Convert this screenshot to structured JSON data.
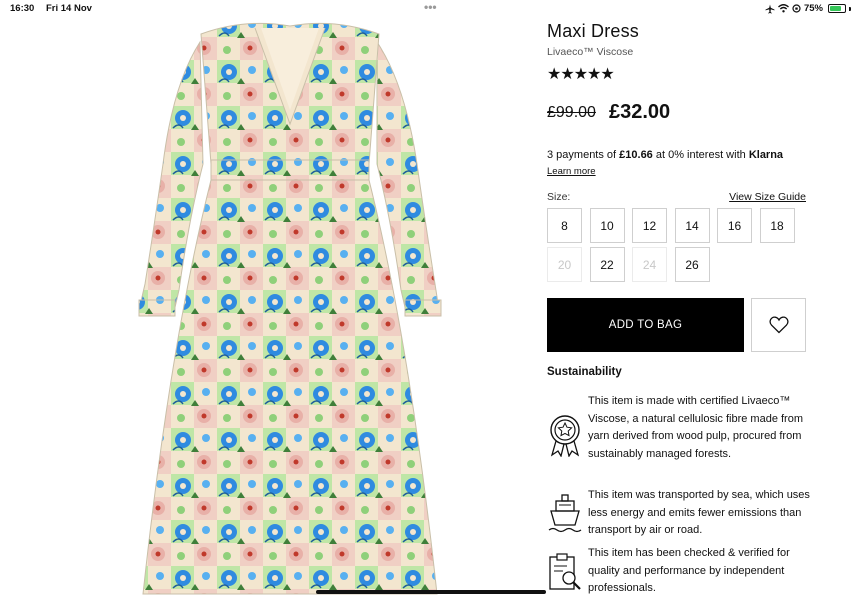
{
  "status_bar": {
    "time": "16:30",
    "date": "Fri 14 Nov",
    "dots": "•••",
    "battery": "75%"
  },
  "product": {
    "title": "Maxi Dress",
    "subtitle": "Livaeco™ Viscose",
    "rating_stars": "★★★★★",
    "rating_value": 5,
    "price_old": "£99.00",
    "price_new": "£32.00"
  },
  "klarna": {
    "prefix": "3 payments of ",
    "amount": "£10.66",
    "middle": " at 0% interest with ",
    "brand": "Klarna",
    "learn_more": "Learn more"
  },
  "sizes": {
    "label": "Size:",
    "guide_link": "View Size Guide",
    "options": [
      {
        "label": "8",
        "available": true
      },
      {
        "label": "10",
        "available": true
      },
      {
        "label": "12",
        "available": true
      },
      {
        "label": "14",
        "available": true
      },
      {
        "label": "16",
        "available": true
      },
      {
        "label": "18",
        "available": true
      },
      {
        "label": "20",
        "available": false
      },
      {
        "label": "22",
        "available": true
      },
      {
        "label": "24",
        "available": false
      },
      {
        "label": "26",
        "available": true
      }
    ]
  },
  "actions": {
    "add_to_bag": "ADD TO BAG",
    "wishlist_icon": "heart-icon"
  },
  "sustainability": {
    "title": "Sustainability",
    "items": [
      {
        "icon": "award-rosette-icon",
        "text": "This item is made with certified Livaeco™ Viscose, a natural cellulosic fibre made from yarn derived from wood pulp, procured from sustainably managed forests."
      },
      {
        "icon": "ship-icon",
        "text": "This item was transported by sea, which uses less energy and emits fewer emissions than transport by air or road."
      },
      {
        "icon": "clipboard-check-icon",
        "text": "This item has been checked & verified for quality and performance by independent professionals."
      }
    ]
  },
  "colors": {
    "button_black": "#000000",
    "border": "#cfcfcf",
    "dress_green": "#b9e3a0",
    "dress_blue": "#2f8be0",
    "dress_cream": "#f3e6cf",
    "dress_pink": "#e7a9a0"
  }
}
